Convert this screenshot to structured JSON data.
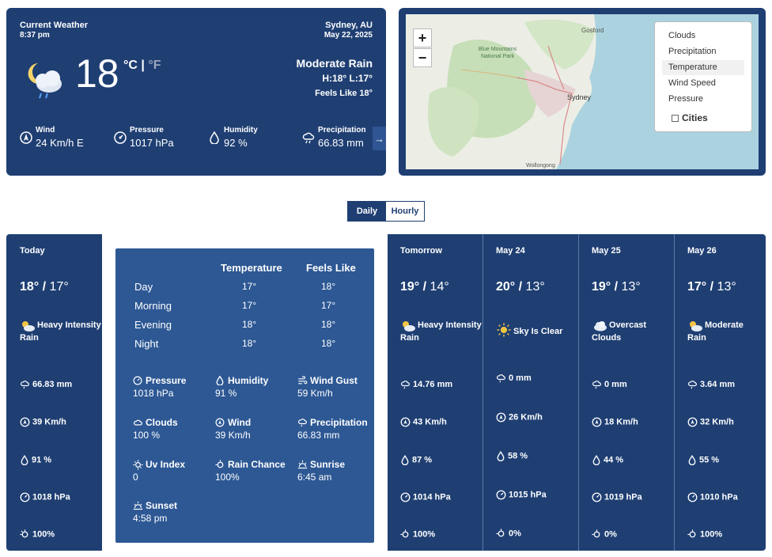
{
  "current": {
    "title": "Current Weather",
    "time": "8:37 pm",
    "location": "Sydney, AU",
    "date": "May 22, 2025",
    "temperature": "18",
    "unit_c": "°C",
    "unit_sep": "|",
    "unit_f": "°F",
    "description": "Moderate Rain",
    "high_low": "H:18° L:17°",
    "feels_like": "Feels Like 18°",
    "stats": [
      {
        "label": "Wind",
        "value": "24 Km/h",
        "extra": "E"
      },
      {
        "label": "Pressure",
        "value": "1017 hPa"
      },
      {
        "label": "Humidity",
        "value": "92 %"
      },
      {
        "label": "Precipitation",
        "value": "66.83 mm"
      }
    ],
    "next_arrow": "→"
  },
  "map": {
    "zoom_in": "+",
    "zoom_out": "−",
    "layers": [
      "Clouds",
      "Precipitation",
      "Temperature",
      "Wind Speed",
      "Pressure"
    ],
    "active_layer": "Temperature",
    "cities_label": "Cities",
    "place_labels": [
      "Gosford",
      "Blue Mountains National Park",
      "Sydney",
      "Wollongong"
    ]
  },
  "toggle": {
    "daily": "Daily",
    "hourly": "Hourly",
    "selected": "Daily"
  },
  "forecast": {
    "today": {
      "name": "Today",
      "high": "18°",
      "sep": " / ",
      "low": "17°",
      "condition": "Heavy Intensity Rain",
      "precip": "66.83 mm",
      "wind": "39 Km/h",
      "humidity": "91 %",
      "pressure": "1018 hPa",
      "rain_chance": "100%"
    },
    "detail": {
      "col_temp": "Temperature",
      "col_feels": "Feels Like",
      "rows": [
        {
          "label": "Day",
          "temp": "17°",
          "feels": "18°"
        },
        {
          "label": "Morning",
          "temp": "17°",
          "feels": "17°"
        },
        {
          "label": "Evening",
          "temp": "18°",
          "feels": "18°"
        },
        {
          "label": "Night",
          "temp": "18°",
          "feels": "18°"
        }
      ],
      "metrics": [
        {
          "label": "Pressure",
          "value": "1018 hPa"
        },
        {
          "label": "Humidity",
          "value": "91 %"
        },
        {
          "label": "Wind Gust",
          "value": "59 Km/h"
        },
        {
          "label": "Clouds",
          "value": "100 %"
        },
        {
          "label": "Wind",
          "value": "39 Km/h"
        },
        {
          "label": "Precipitation",
          "value": "66.83 mm"
        },
        {
          "label": "Uv Index",
          "value": "0"
        },
        {
          "label": "Rain Chance",
          "value": "100%"
        },
        {
          "label": "Sunrise",
          "value": "6:45 am"
        },
        {
          "label": "Sunset",
          "value": "4:58 pm"
        }
      ]
    },
    "days": [
      {
        "name": "Tomorrow",
        "high": "19°",
        "sep": " / ",
        "low": "14°",
        "condition": "Heavy Intensity Rain",
        "icon": "cloud-sun-icon",
        "precip": "14.76 mm",
        "wind": "43 Km/h",
        "humidity": "87 %",
        "pressure": "1014 hPa",
        "rain_chance": "100%"
      },
      {
        "name": "May 24",
        "high": "20°",
        "sep": " / ",
        "low": "13°",
        "condition": "Sky Is Clear",
        "icon": "sun-icon",
        "precip": "0 mm",
        "wind": "26 Km/h",
        "humidity": "58 %",
        "pressure": "1015 hPa",
        "rain_chance": "0%"
      },
      {
        "name": "May 25",
        "high": "19°",
        "sep": " / ",
        "low": "13°",
        "condition": "Overcast Clouds",
        "icon": "cloud-icon",
        "precip": "0 mm",
        "wind": "18 Km/h",
        "humidity": "44 %",
        "pressure": "1019 hPa",
        "rain_chance": "0%"
      },
      {
        "name": "May 26",
        "high": "17°",
        "sep": " / ",
        "low": "13°",
        "condition": "Moderate Rain",
        "icon": "cloud-sun-icon",
        "precip": "3.64 mm",
        "wind": "32 Km/h",
        "humidity": "55 %",
        "pressure": "1010 hPa",
        "rain_chance": "100%"
      }
    ]
  }
}
